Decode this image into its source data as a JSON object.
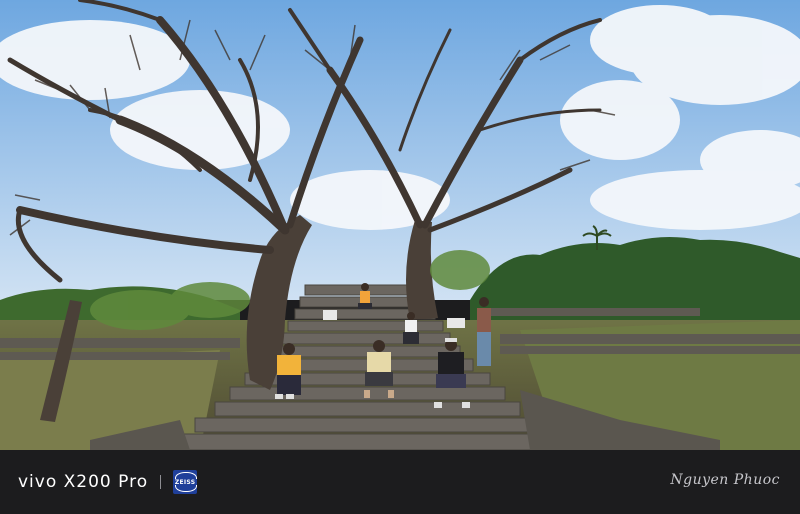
{
  "photo": {
    "description_alt": "",
    "colors": {
      "sky": "#7fb3e6",
      "cloud": "#f4f7fb",
      "foliage_dark": "#2f5a2a",
      "foliage_light": "#5f8a3c",
      "grass": "#7a7a4a",
      "stone": "#6b6660",
      "trunk": "#4a4038"
    }
  },
  "watermark": {
    "device_model": "vivo X200 Pro",
    "lens_brand": "ZEISS",
    "photographer_signature": "Nguyen Phuoc"
  }
}
